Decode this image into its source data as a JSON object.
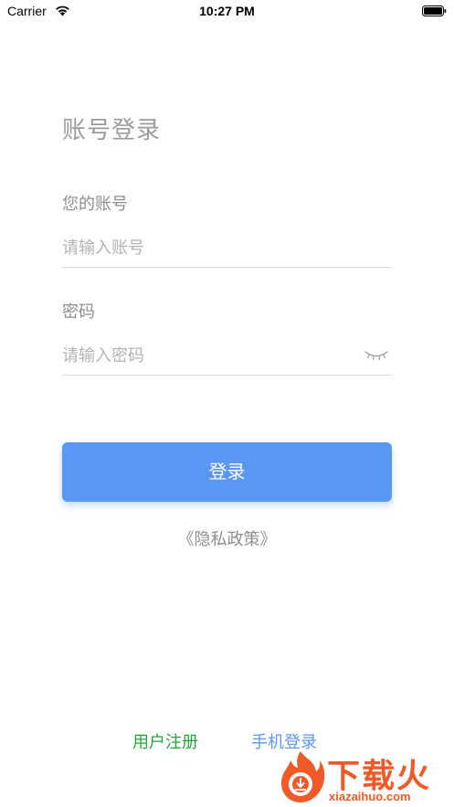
{
  "status_bar": {
    "carrier": "Carrier",
    "time": "10:27 PM"
  },
  "page": {
    "title": "账号登录"
  },
  "account": {
    "label": "您的账号",
    "placeholder": "请输入账号",
    "value": ""
  },
  "password": {
    "label": "密码",
    "placeholder": "请输入密码",
    "value": "",
    "toggle_icon": "eye-closed-icon"
  },
  "actions": {
    "login_label": "登录",
    "privacy_label": "《隐私政策》",
    "register_label": "用户注册",
    "phone_login_label": "手机登录"
  },
  "watermark": {
    "text": "下载火",
    "url": "xiazaihuo.com"
  },
  "colors": {
    "primary": "#5a97f5",
    "register_green": "#24a538",
    "watermark_orange": "#ef5a28"
  }
}
